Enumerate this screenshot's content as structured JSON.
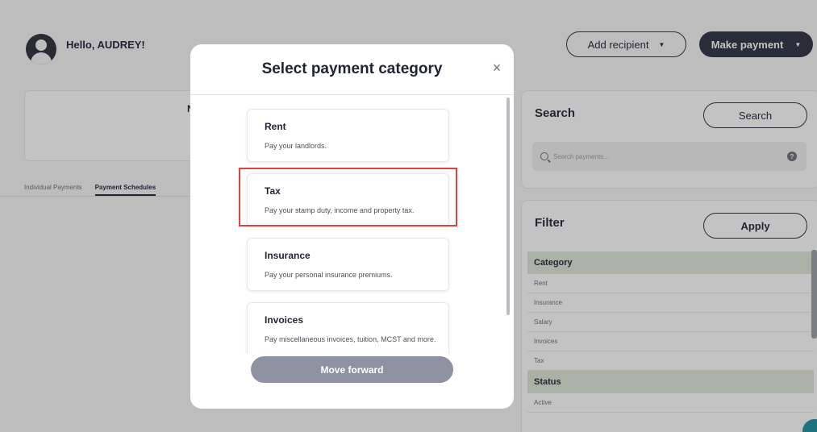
{
  "user": {
    "greeting": "Hello, AUDREY!"
  },
  "summary": {
    "partial_text": "N"
  },
  "tabs": [
    {
      "label": "Individual Payments",
      "active": false
    },
    {
      "label": "Payment Schedules",
      "active": true
    }
  ],
  "header_actions": {
    "add_recipient_label": "Add recipient",
    "make_payment_label": "Make payment"
  },
  "search_panel": {
    "title": "Search",
    "button_label": "Search",
    "placeholder": "Search payments...",
    "help_icon": "?"
  },
  "filter_panel": {
    "title": "Filter",
    "button_label": "Apply",
    "category_heading": "Category",
    "categories": [
      "Rent",
      "Insurance",
      "Salary",
      "Invoices",
      "Tax"
    ],
    "status_heading": "Status",
    "statuses": [
      "Active"
    ]
  },
  "modal": {
    "title": "Select payment category",
    "close_icon": "×",
    "categories": [
      {
        "title": "Rent",
        "description": "Pay your landlords."
      },
      {
        "title": "Tax",
        "description": "Pay your stamp duty, income and property tax."
      },
      {
        "title": "Insurance",
        "description": "Pay your personal insurance premiums."
      },
      {
        "title": "Invoices",
        "description": "Pay miscellaneous invoices, tuition, MCST and more."
      }
    ],
    "primary_button_label": "Move forward"
  },
  "colors": {
    "primary_dark": "#2b2e42",
    "disabled_button": "#8f92a0",
    "highlight_border": "#e0433f",
    "filter_heading_bg": "#dfe7d8"
  }
}
